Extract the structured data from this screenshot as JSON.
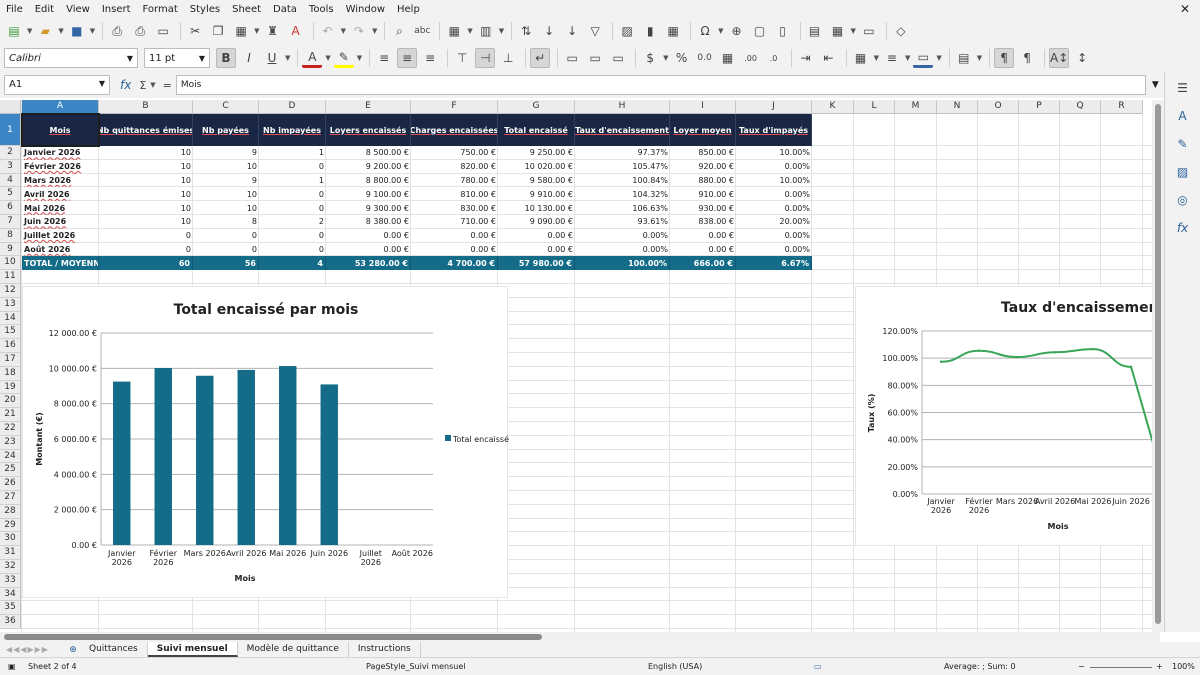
{
  "menu": [
    "File",
    "Edit",
    "View",
    "Insert",
    "Format",
    "Styles",
    "Sheet",
    "Data",
    "Tools",
    "Window",
    "Help"
  ],
  "toolbar": {
    "font_name": "Calibri",
    "font_size": "11 pt"
  },
  "formula": {
    "cell_ref": "A1",
    "content": "Mois"
  },
  "columns": [
    "A",
    "B",
    "C",
    "D",
    "E",
    "F",
    "G",
    "H",
    "I",
    "J",
    "K",
    "L",
    "M",
    "N",
    "O",
    "P",
    "Q",
    "R"
  ],
  "rows": [
    "1",
    "2",
    "3",
    "4",
    "5",
    "6",
    "7",
    "8",
    "9",
    "10",
    "11",
    "12",
    "13",
    "14",
    "15",
    "16",
    "17",
    "18",
    "19",
    "20",
    "21",
    "22",
    "23",
    "24",
    "25",
    "26",
    "27",
    "28",
    "29",
    "30",
    "31",
    "32",
    "33",
    "34",
    "35",
    "36"
  ],
  "table": {
    "headers": [
      "Mois",
      "Nb quittances émises",
      "Nb payées",
      "Nb impayées",
      "Loyers encaissés",
      "Charges encaissées",
      "Total encaissé",
      "Taux d'encaissement",
      "Loyer moyen",
      "Taux d'impayés"
    ],
    "rows": [
      [
        "Janvier 2026",
        "10",
        "9",
        "1",
        "8 500.00 €",
        "750.00 €",
        "9 250.00 €",
        "97.37%",
        "850.00 €",
        "10.00%"
      ],
      [
        "Février 2026",
        "10",
        "10",
        "0",
        "9 200.00 €",
        "820.00 €",
        "10 020.00 €",
        "105.47%",
        "920.00 €",
        "0.00%"
      ],
      [
        "Mars 2026",
        "10",
        "9",
        "1",
        "8 800.00 €",
        "780.00 €",
        "9 580.00 €",
        "100.84%",
        "880.00 €",
        "10.00%"
      ],
      [
        "Avril 2026",
        "10",
        "10",
        "0",
        "9 100.00 €",
        "810.00 €",
        "9 910.00 €",
        "104.32%",
        "910.00 €",
        "0.00%"
      ],
      [
        "Mai 2026",
        "10",
        "10",
        "0",
        "9 300.00 €",
        "830.00 €",
        "10 130.00 €",
        "106.63%",
        "930.00 €",
        "0.00%"
      ],
      [
        "Juin 2026",
        "10",
        "8",
        "2",
        "8 380.00 €",
        "710.00 €",
        "9 090.00 €",
        "93.61%",
        "838.00 €",
        "20.00%"
      ],
      [
        "Juillet 2026",
        "0",
        "0",
        "0",
        "0.00 €",
        "0.00 €",
        "0.00 €",
        "0.00%",
        "0.00 €",
        "0.00%"
      ],
      [
        "Août 2026",
        "0",
        "0",
        "0",
        "0.00 €",
        "0.00 €",
        "0.00 €",
        "0.00%",
        "0.00 €",
        "0.00%"
      ]
    ],
    "total": [
      "TOTAL / MOYENNE",
      "60",
      "56",
      "4",
      "53 280.00 €",
      "4 700.00 €",
      "57 980.00 €",
      "100.00%",
      "666.00 €",
      "6.67%"
    ]
  },
  "chart_data": [
    {
      "type": "bar",
      "title": "Total encaissé par mois",
      "xlabel": "Mois",
      "ylabel": "Montant (€)",
      "categories": [
        "Janvier 2026",
        "Février 2026",
        "Mars 2026",
        "Avril 2026",
        "Mai 2026",
        "Juin 2026",
        "Juillet 2026",
        "Août 2026"
      ],
      "series": [
        {
          "name": "Total encaissé",
          "values": [
            9250,
            10020,
            9580,
            9910,
            10130,
            9090,
            0,
            0
          ]
        }
      ],
      "ylim": [
        0,
        12000
      ],
      "yticks": [
        "0.00 €",
        "2 000.00 €",
        "4 000.00 €",
        "6 000.00 €",
        "8 000.00 €",
        "10 000.00 €",
        "12 000.00 €"
      ],
      "legend": "right",
      "color": "#146c89"
    },
    {
      "type": "line",
      "title": "Taux d'encaissement m",
      "xlabel": "Mois",
      "ylabel": "Taux (%)",
      "categories": [
        "Janvier 2026",
        "Février 2026",
        "Mars 2026",
        "Avril 2026",
        "Mai 2026",
        "Juin 2026"
      ],
      "series": [
        {
          "values": [
            97.37,
            105.47,
            100.84,
            104.32,
            106.63,
            93.61
          ]
        }
      ],
      "ylim": [
        0,
        120
      ],
      "yticks": [
        "0.00%",
        "20.00%",
        "40.00%",
        "60.00%",
        "80.00%",
        "100.00%",
        "120.00%"
      ],
      "color": "#3aa657"
    }
  ],
  "sheet_tabs": [
    "Quittances",
    "Suivi mensuel",
    "Modèle de quittance",
    "Instructions"
  ],
  "status": {
    "sheet": "Sheet 2 of 4",
    "page_style": "PageStyle_Suivi mensuel",
    "language": "English (USA)",
    "summary": "Average: ; Sum: 0",
    "zoom": "100%"
  }
}
